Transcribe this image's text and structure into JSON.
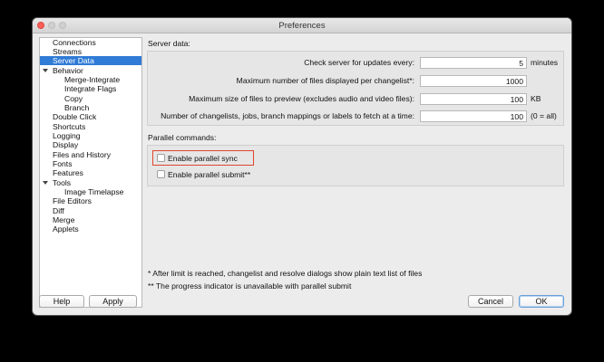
{
  "window": {
    "title": "Preferences"
  },
  "sidebar": {
    "items": [
      {
        "label": "Connections"
      },
      {
        "label": "Streams"
      },
      {
        "label": "Server Data",
        "selected": true
      },
      {
        "label": "Behavior",
        "expanded": true
      },
      {
        "label": "Merge-Integrate"
      },
      {
        "label": "Integrate Flags"
      },
      {
        "label": "Copy"
      },
      {
        "label": "Branch"
      },
      {
        "label": "Double Click"
      },
      {
        "label": "Shortcuts"
      },
      {
        "label": "Logging"
      },
      {
        "label": "Display"
      },
      {
        "label": "Files and History"
      },
      {
        "label": "Fonts"
      },
      {
        "label": "Features"
      },
      {
        "label": "Tools",
        "expanded": true
      },
      {
        "label": "Image Timelapse"
      },
      {
        "label": "File Editors"
      },
      {
        "label": "Diff"
      },
      {
        "label": "Merge"
      },
      {
        "label": "Applets"
      }
    ]
  },
  "server_data": {
    "heading": "Server data:",
    "rows": [
      {
        "label": "Check server for updates every:",
        "value": "5",
        "unit": "minutes"
      },
      {
        "label": "Maximum number of files displayed per changelist*:",
        "value": "1000",
        "unit": ""
      },
      {
        "label": "Maximum size of files to preview (excludes audio and video files):",
        "value": "100",
        "unit": "KB"
      },
      {
        "label": "Number of changelists, jobs, branch mappings or labels to fetch at a time:",
        "value": "100",
        "unit": "(0 = all)"
      }
    ]
  },
  "parallel": {
    "heading": "Parallel commands:",
    "sync_label": "Enable parallel sync",
    "sync_checked": false,
    "submit_label": "Enable parallel submit**",
    "submit_checked": false
  },
  "notes": {
    "note1": "* After limit is reached, changelist and resolve dialogs show plain text list of files",
    "note2": "** The progress indicator is unavailable with parallel submit"
  },
  "buttons": {
    "help": "Help",
    "apply": "Apply",
    "cancel": "Cancel",
    "ok": "OK"
  },
  "colors": {
    "selection": "#2f7bd6",
    "highlight_border": "#e0452f",
    "close_light": "#fc5f57"
  }
}
